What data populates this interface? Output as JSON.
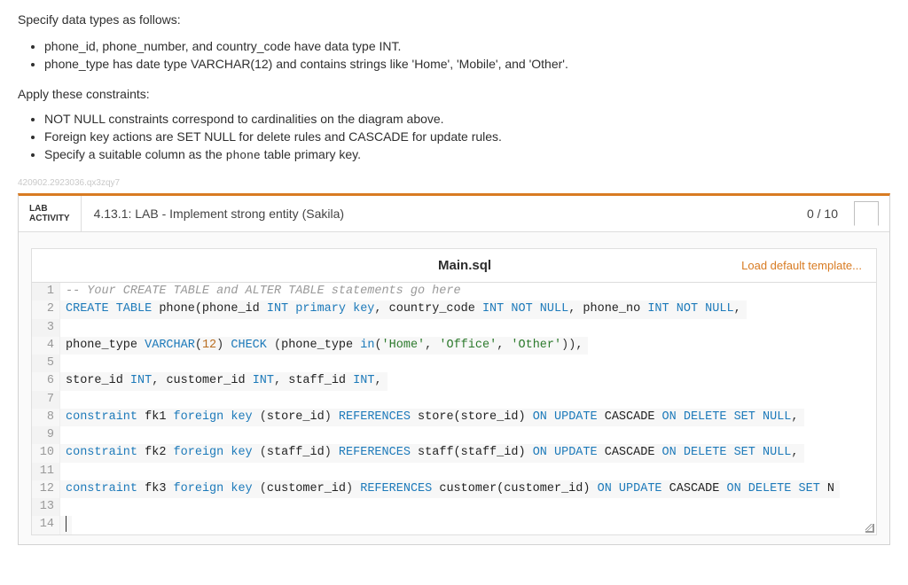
{
  "intro": {
    "heading": "Specify data types as follows:",
    "items": [
      "phone_id, phone_number, and country_code have data type INT.",
      "phone_type has date type VARCHAR(12) and contains strings like 'Home', 'Mobile', and 'Other'."
    ],
    "constraints_heading": "Apply these constraints:",
    "constraints": [
      "NOT NULL constraints correspond to cardinalities on the diagram above.",
      "Foreign key actions are SET NULL for delete rules and CASCADE for update rules.",
      "Specify a suitable column as the phone table primary key."
    ],
    "mono_token": "phone",
    "faded_id": "420902.2923036.qx3zqy7"
  },
  "activity": {
    "tag_line1": "LAB",
    "tag_line2": "ACTIVITY",
    "title": "4.13.1: LAB - Implement strong entity (Sakila)",
    "score": "0 / 10"
  },
  "editor": {
    "filename": "Main.sql",
    "load_template": "Load default template...",
    "code_lines": [
      {
        "n": 1,
        "html": "<span class='c-comment'>-- Your CREATE TABLE and ALTER TABLE statements go here</span>"
      },
      {
        "n": 2,
        "html": "<span class='c-key'>CREATE TABLE</span> <span class='c-name'>phone(phone_id</span> <span class='c-type'>INT</span> <span class='c-key'>primary key</span><span class='c-op'>,</span> <span class='c-name'>country_code</span> <span class='c-type'>INT</span> <span class='c-key'>NOT NULL</span><span class='c-op'>,</span> <span class='c-name'>phone_no</span> <span class='c-type'>INT</span> <span class='c-key'>NOT NULL</span><span class='c-op'>,</span>"
      },
      {
        "n": 3,
        "html": ""
      },
      {
        "n": 4,
        "html": "<span class='c-name'>phone_type</span> <span class='c-type'>VARCHAR</span><span class='c-op'>(</span><span class='c-kw2'>12</span><span class='c-op'>)</span> <span class='c-key'>CHECK</span> <span class='c-op'>(</span><span class='c-name'>phone_type</span> <span class='c-key'>in</span><span class='c-op'>(</span><span class='c-str'>'Home'</span><span class='c-op'>,</span> <span class='c-str'>'Office'</span><span class='c-op'>,</span> <span class='c-str'>'Other'</span><span class='c-op'>)),</span>"
      },
      {
        "n": 5,
        "html": ""
      },
      {
        "n": 6,
        "html": "<span class='c-name'>store_id</span> <span class='c-type'>INT</span><span class='c-op'>,</span> <span class='c-name'>customer_id</span> <span class='c-type'>INT</span><span class='c-op'>,</span> <span class='c-name'>staff_id</span> <span class='c-type'>INT</span><span class='c-op'>,</span>"
      },
      {
        "n": 7,
        "html": ""
      },
      {
        "n": 8,
        "html": "<span class='c-key'>constraint</span> <span class='c-name'>fk1</span> <span class='c-key'>foreign key</span> <span class='c-op'>(</span><span class='c-name'>store_id</span><span class='c-op'>)</span> <span class='c-key'>REFERENCES</span> <span class='c-name'>store(store_id)</span> <span class='c-key'>ON UPDATE</span> <span class='c-name'>CASCADE</span> <span class='c-key'>ON DELETE</span> <span class='c-key'>SET</span> <span class='c-key'>NULL</span><span class='c-op'>,</span>"
      },
      {
        "n": 9,
        "html": ""
      },
      {
        "n": 10,
        "html": "<span class='c-key'>constraint</span> <span class='c-name'>fk2</span> <span class='c-key'>foreign key</span> <span class='c-op'>(</span><span class='c-name'>staff_id</span><span class='c-op'>)</span> <span class='c-key'>REFERENCES</span> <span class='c-name'>staff(staff_id)</span> <span class='c-key'>ON UPDATE</span> <span class='c-name'>CASCADE</span> <span class='c-key'>ON DELETE</span> <span class='c-key'>SET</span> <span class='c-key'>NULL</span><span class='c-op'>,</span>"
      },
      {
        "n": 11,
        "html": ""
      },
      {
        "n": 12,
        "html": "<span class='c-key'>constraint</span> <span class='c-name'>fk3</span> <span class='c-key'>foreign key</span> <span class='c-op'>(</span><span class='c-name'>customer_id</span><span class='c-op'>)</span> <span class='c-key'>REFERENCES</span> <span class='c-name'>customer(customer_id)</span> <span class='c-key'>ON UPDATE</span> <span class='c-name'>CASCADE</span> <span class='c-key'>ON DELETE</span> <span class='c-key'>SET</span> <span class='c-name'>N</span>"
      },
      {
        "n": 13,
        "html": ""
      },
      {
        "n": 14,
        "html": "<span class='cursor-line'></span>"
      }
    ]
  }
}
